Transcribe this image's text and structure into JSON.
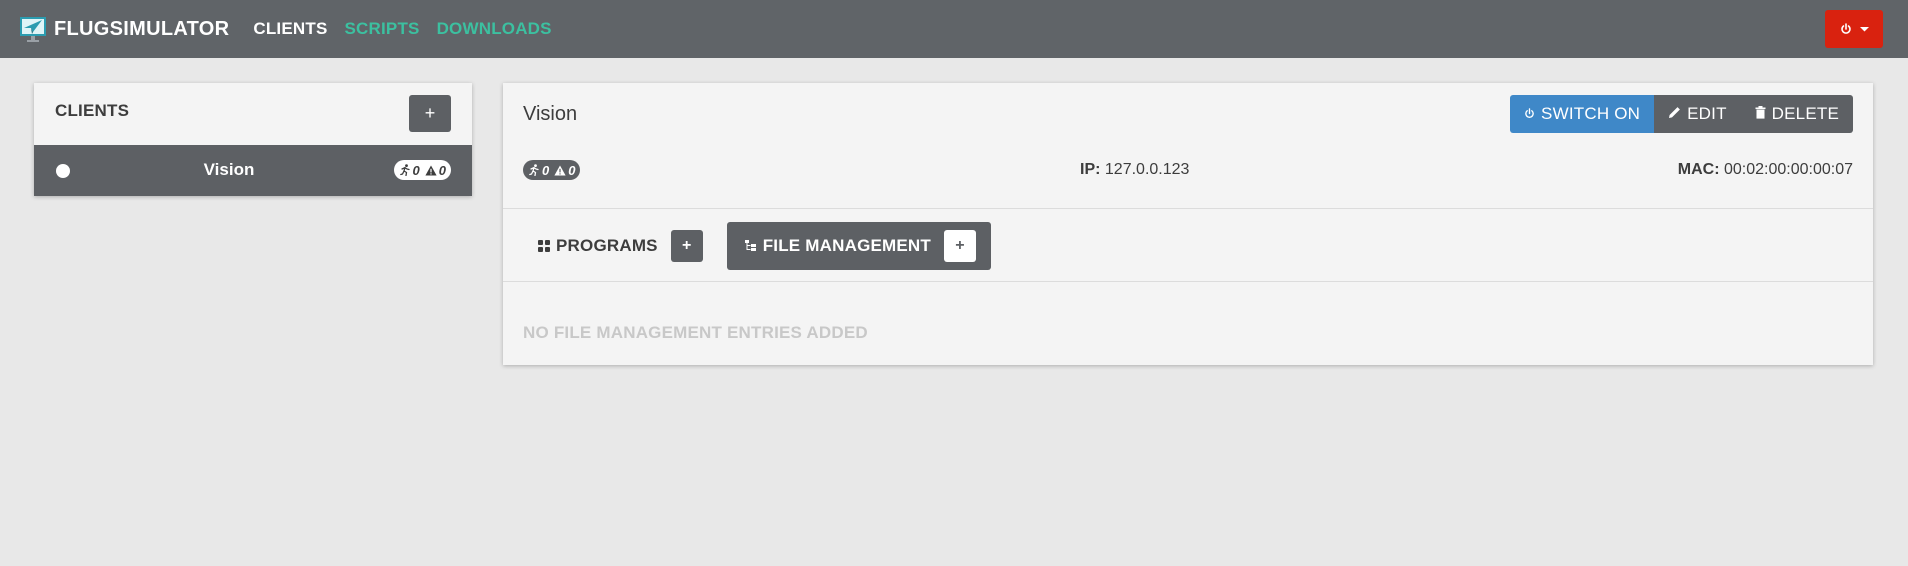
{
  "app": {
    "brand": "FLUGSIMULATOR",
    "accent_color": "#3cc0a0",
    "danger_color": "#d9220f"
  },
  "nav": {
    "items": [
      {
        "label": "CLIENTS",
        "active": true
      },
      {
        "label": "SCRIPTS",
        "active": false
      },
      {
        "label": "DOWNLOADS",
        "active": false
      }
    ],
    "power_icon": "power-icon"
  },
  "clients": {
    "title": "CLIENTS",
    "add_label": "+",
    "items": [
      {
        "name": "Vision",
        "status_icon": "status-dot-icon",
        "running_count": "0",
        "warning_count": "0"
      }
    ]
  },
  "detail": {
    "title": "Vision",
    "actions": {
      "switch_on": "SWITCH ON",
      "edit": "EDIT",
      "delete": "DELETE"
    },
    "running_count": "0",
    "warning_count": "0",
    "ip_label": "IP:",
    "ip_value": "127.0.0.123",
    "mac_label": "MAC:",
    "mac_value": "00:02:00:00:00:07",
    "tabs": {
      "programs": "PROGRAMS",
      "file_management": "FILE MANAGEMENT",
      "add_label": "+"
    },
    "empty_message": "NO FILE MANAGEMENT ENTRIES ADDED"
  }
}
